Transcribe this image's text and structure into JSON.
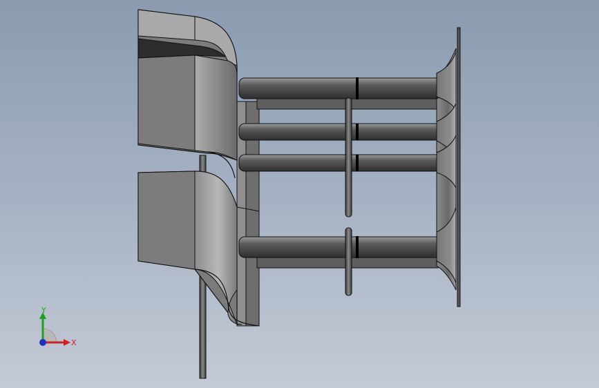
{
  "viewport": {
    "background_top": "#8a9bb0",
    "background_bottom": "#c4cad6"
  },
  "model": {
    "part_color": "#6f6f6f",
    "part_dark": "#3c3c3c",
    "part_light": "#b5b5b5",
    "edge_color": "#111111",
    "pipe_count": 4
  },
  "triad": {
    "x_label": "X",
    "y_label": "Y",
    "x_color": "#d02020",
    "y_color": "#20a020",
    "z_color": "#2030c0"
  }
}
